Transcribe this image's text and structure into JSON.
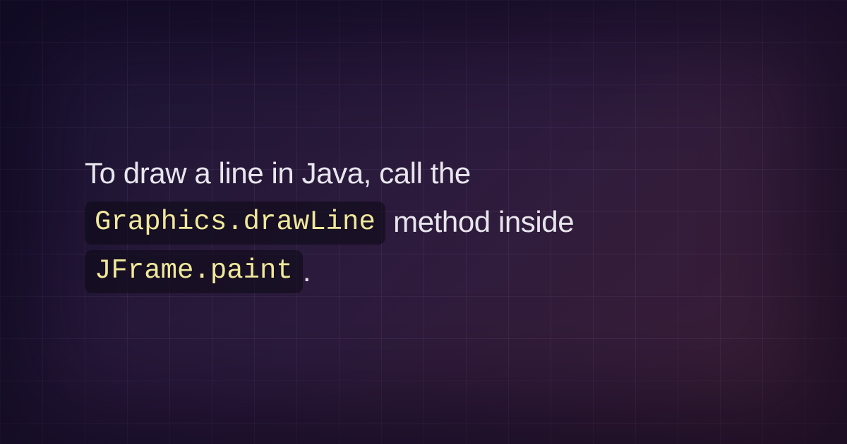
{
  "sentence": {
    "part1": "To draw a line in Java, call the ",
    "code1": "Graphics.drawLine",
    "part2": " method inside ",
    "code2": "JFrame.paint",
    "part3": "."
  }
}
